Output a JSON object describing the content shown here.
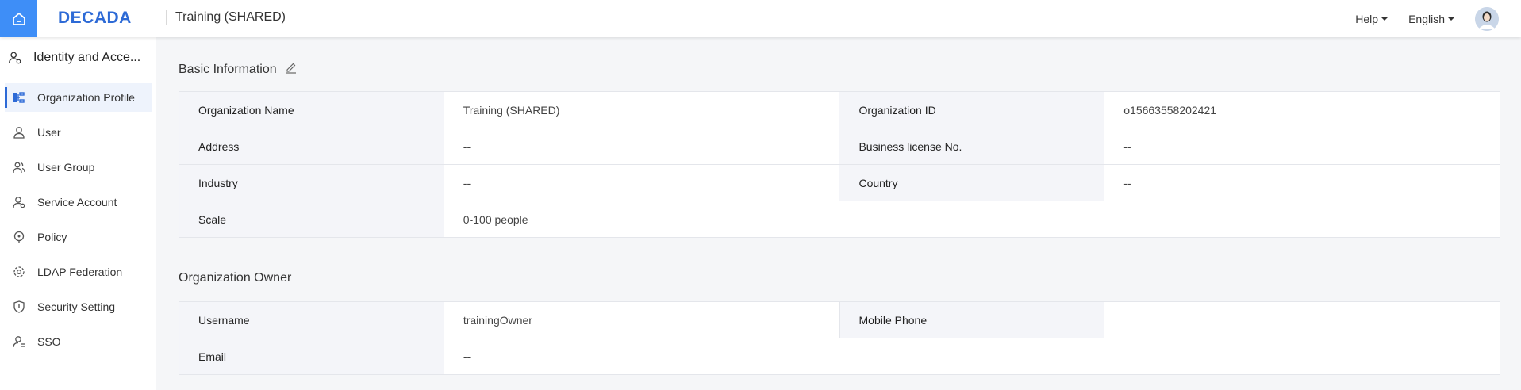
{
  "header": {
    "logo": "DECADA",
    "org_title": "Training (SHARED)",
    "help": "Help",
    "language": "English"
  },
  "sidebar": {
    "title": "Identity and Acce...",
    "items": [
      {
        "label": "Organization Profile",
        "icon": "org-chart-icon",
        "active": true
      },
      {
        "label": "User",
        "icon": "user-icon"
      },
      {
        "label": "User Group",
        "icon": "user-group-icon"
      },
      {
        "label": "Service Account",
        "icon": "service-account-icon"
      },
      {
        "label": "Policy",
        "icon": "policy-icon"
      },
      {
        "label": "LDAP Federation",
        "icon": "ldap-icon"
      },
      {
        "label": "Security Setting",
        "icon": "shield-icon"
      },
      {
        "label": "SSO",
        "icon": "sso-icon"
      }
    ]
  },
  "basic_info": {
    "title": "Basic Information",
    "org_name_label": "Organization Name",
    "org_name": "Training (SHARED)",
    "org_id_label": "Organization ID",
    "org_id": "o15663558202421",
    "address_label": "Address",
    "address": "--",
    "license_label": "Business license No.",
    "license": "--",
    "industry_label": "Industry",
    "industry": "--",
    "country_label": "Country",
    "country": "--",
    "scale_label": "Scale",
    "scale": "0-100 people"
  },
  "owner": {
    "title": "Organization Owner",
    "username_label": "Username",
    "username": "trainingOwner",
    "mobile_label": "Mobile Phone",
    "mobile": "",
    "email_label": "Email",
    "email": "--"
  },
  "colors": {
    "accent": "#3e8ef7",
    "brand": "#2d6ad6"
  }
}
